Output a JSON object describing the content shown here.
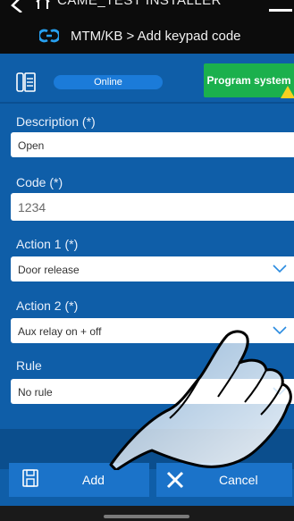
{
  "header": {
    "installer_name": "CAME_TEST INSTALLER",
    "breadcrumb": "MTM/KB > Add keypad code"
  },
  "status_bar": {
    "connection_status": "Online",
    "program_system_label": "Program system"
  },
  "form": {
    "description": {
      "label": "Description (*)",
      "value": "Open"
    },
    "code": {
      "label": "Code (*)",
      "value": "1234"
    },
    "action1": {
      "label": "Action 1 (*)",
      "value": "Door release"
    },
    "action2": {
      "label": "Action 2 (*)",
      "value": "Aux relay on + off"
    },
    "rule": {
      "label": "Rule",
      "value": "No rule"
    }
  },
  "buttons": {
    "add_label": "Add",
    "cancel_label": "Cancel"
  },
  "colors": {
    "background": "#0f5ea8",
    "program_button": "#1bb04d",
    "warning": "#f6d020",
    "status_pill": "#1b7bd9"
  }
}
